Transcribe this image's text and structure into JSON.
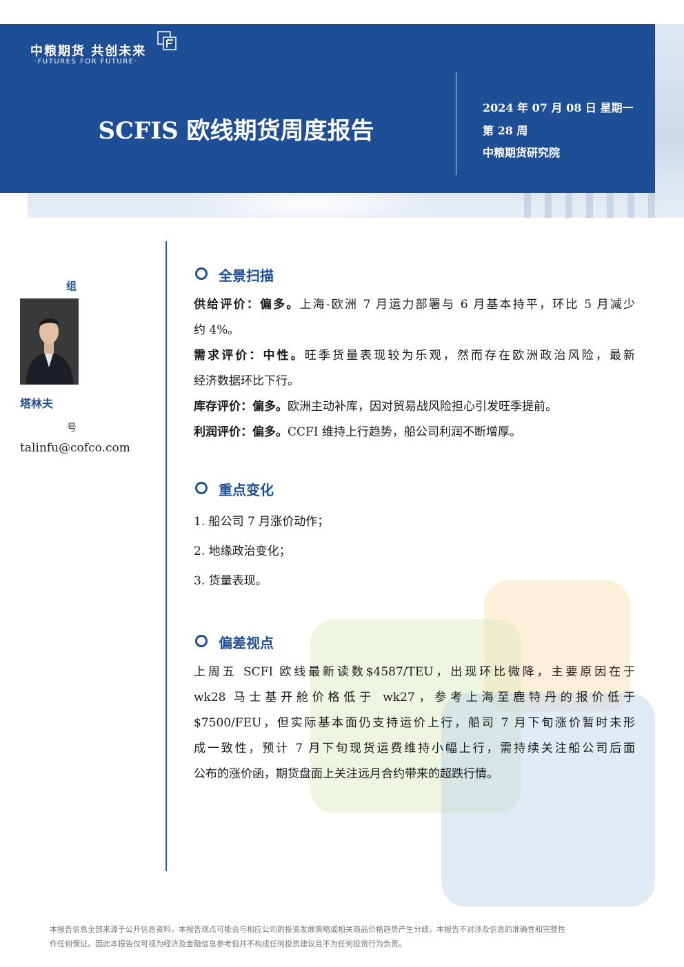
{
  "header": {
    "logo_cn": "中粮期货 共创未来",
    "logo_en": "·FUTURES FOR FUTURE·",
    "title": "SCFIS 欧线期货周度报告",
    "date": "2024 年 07 月 08 日 星期一",
    "week": "第 28 周",
    "institute": "中粮期货研究院",
    "band_color": "#1e4f96"
  },
  "sidebar": {
    "group": "组",
    "author": "塔林夫",
    "hao": "号",
    "email": "talinfu@cofco.com"
  },
  "sections": {
    "overview": {
      "title": "全景扫描",
      "supply_label": "供给评价：偏多。",
      "supply_line1": "上海-欧洲 7 月运力部署与 6 月基本持平，环比 5 月减少",
      "supply_line2": "约 4%。",
      "demand_label": "需求评价：中性。",
      "demand_line1": "旺季货量表现较为乐观，然而存在欧洲政治风险，最新",
      "demand_line2": "经济数据环比下行。",
      "inventory_label": "库存评价：偏多。",
      "inventory_text": "欧洲主动补库，因对贸易战风险担心引发旺季提前。",
      "profit_label": "利润评价：偏多。",
      "profit_text": "CCFI 维持上行趋势，船公司利润不断增厚。"
    },
    "changes": {
      "title": "重点变化",
      "items": [
        "1.  船公司 7 月涨价动作；",
        "2.  地缘政治变化；",
        "3.  货量表现。"
      ]
    },
    "view": {
      "title": "偏差视点",
      "lines": [
        "上周五 SCFI 欧线最新读数$4587/TEU，出现环比微降，主要原因在于",
        "wk28 马士基开舱价格低于 wk27，参考上海至鹿特丹的报价低于",
        "$7500/FEU，但实际基本面仍支持运价上行，船司 7 月下旬涨价暂时未形",
        "成一致性，预计 7 月下旬现货运费维持小幅上行，需持续关注船公司后面",
        "公布的涨价函，期货盘面上关注远月合约带来的超跌行情。"
      ]
    }
  },
  "footer": {
    "line1": "本报告信息全部来源于公开信息资料，本报告观点可能会与相应公司的投资发展策略或相关商品价格趋势产生分歧，本报告不对涉及信息的准确性和完整性",
    "line2": "作任何保证。因此本报告仅可视为经济及金融信息参考但并不构成任何投资建议且不为任何投资行为负责。"
  }
}
